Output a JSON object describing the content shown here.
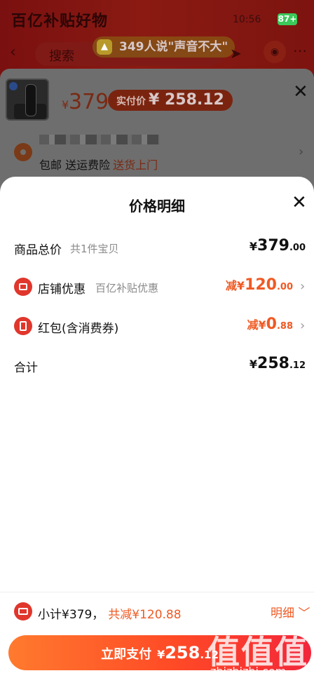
{
  "background": {
    "status_title": "百亿补贴好物",
    "time": "10:56",
    "battery": "87+",
    "search_text": "搜索",
    "toast": {
      "count": "349",
      "text": "人说\"声音不大\""
    },
    "price_yen": "¥",
    "price": "379",
    "actual_label": "实付价",
    "actual_value": "¥ 258.12",
    "address_services": "包邮 送运费险",
    "address_highlight": "送货上门"
  },
  "sheet": {
    "title": "价格明细",
    "rows": [
      {
        "label": "商品总价",
        "sub": "共1件宝贝",
        "prefix": "¥",
        "int": "379",
        "dec": ".00"
      },
      {
        "label": "店铺优惠",
        "sub": "百亿补贴优惠",
        "prefix": "减¥",
        "int": "120",
        "dec": ".00"
      },
      {
        "label": "红包(含消费券)",
        "sub": "",
        "prefix": "减¥",
        "int": "0",
        "dec": ".88"
      },
      {
        "label": "合计",
        "sub": "",
        "prefix": "¥",
        "int": "258",
        "dec": ".12"
      }
    ]
  },
  "bottom_bar": {
    "subtotal": "小计¥379，",
    "discount": "共减¥120.88",
    "detail": "明细 ﹀",
    "pay_label": "立即支付",
    "pay_yen": "¥",
    "pay_int": "258",
    "pay_dec": ".12"
  },
  "watermark": {
    "text": "值值值",
    "url": "zhizhizhi.com"
  },
  "colors": {
    "accent": "#ef5a24",
    "icon_red": "#e0362c",
    "pay_start": "#ff7a2e",
    "pay_end": "#f2263a"
  },
  "icons": [
    "back-icon",
    "share-icon",
    "cart-icon",
    "more-icon",
    "close-icon",
    "location-icon",
    "shop-discount-icon",
    "red-packet-icon",
    "chevron-right-icon",
    "coupon-icon"
  ]
}
